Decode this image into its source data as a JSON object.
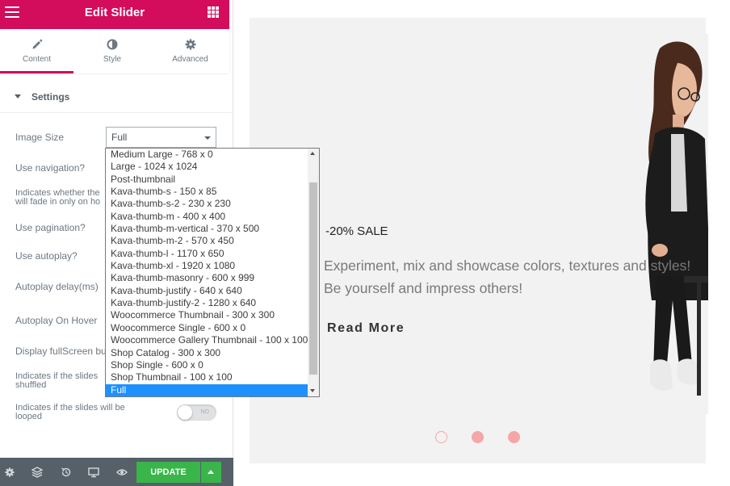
{
  "header": {
    "title": "Edit Slider",
    "menu_icon": "hamburger-icon",
    "apps_icon": "grid-icon"
  },
  "tabs": [
    {
      "label": "Content",
      "icon": "pencil-icon",
      "active": true
    },
    {
      "label": "Style",
      "icon": "contrast-icon",
      "active": false
    },
    {
      "label": "Advanced",
      "icon": "gear-icon",
      "active": false
    }
  ],
  "section": {
    "title": "Settings"
  },
  "controls": {
    "image_size_label": "Image Size",
    "image_size_value": "Full",
    "use_navigation": "Use navigation?",
    "navigation_desc_1": "Indicates whether the",
    "navigation_desc_2": "will fade in only on ho",
    "use_pagination": "Use pagination?",
    "use_autoplay": "Use autoplay?",
    "autoplay_delay": "Autoplay delay(ms)",
    "autoplay_on_hover": "Autoplay On Hover",
    "display_fullscreen": "Display fullScreen bu",
    "shuffle_desc_1": "Indicates if the slides",
    "shuffle_desc_2": "shuffled",
    "loop_desc_1": "Indicates if the slides will be",
    "loop_desc_2": "looped",
    "loop_toggle_text": "NO"
  },
  "dropdown": {
    "options": [
      "Medium Large - 768 x 0",
      "Large - 1024 x 1024",
      "Post-thumbnail",
      "Kava-thumb-s - 150 x 85",
      "Kava-thumb-s-2 - 230 x 230",
      "Kava-thumb-m - 400 x 400",
      "Kava-thumb-m-vertical - 370 x 500",
      "Kava-thumb-m-2 - 570 x 450",
      "Kava-thumb-l - 1170 x 650",
      "Kava-thumb-xl - 1920 x 1080",
      "Kava-thumb-masonry - 600 x 999",
      "Kava-thumb-justify - 640 x 640",
      "Kava-thumb-justify-2 - 1280 x 640",
      "Woocommerce Thumbnail - 300 x 300",
      "Woocommerce Single - 600 x 0",
      "Woocommerce Gallery Thumbnail - 100 x 100",
      "Shop Catalog - 300 x 300",
      "Shop Single - 600 x 0",
      "Shop Thumbnail - 100 x 100",
      "Full"
    ],
    "selected": "Full"
  },
  "footer": {
    "update_label": "UPDATE",
    "icons": [
      "gear-icon",
      "layers-icon",
      "history-icon",
      "responsive-icon",
      "eye-icon"
    ]
  },
  "slide": {
    "sale": "-20% SALE",
    "desc_line_1": "Experiment, mix and showcase colors, textures and styles!",
    "desc_line_2": "Be yourself and impress others!",
    "button": "Read More",
    "pagination_active": 1,
    "pagination_count": 3
  },
  "colors": {
    "brand": "#d30c5c",
    "update_green": "#39b54a",
    "footer_bg": "#556068",
    "selection_blue": "#1e90ff",
    "dot_pink": "#f5a6a8"
  }
}
